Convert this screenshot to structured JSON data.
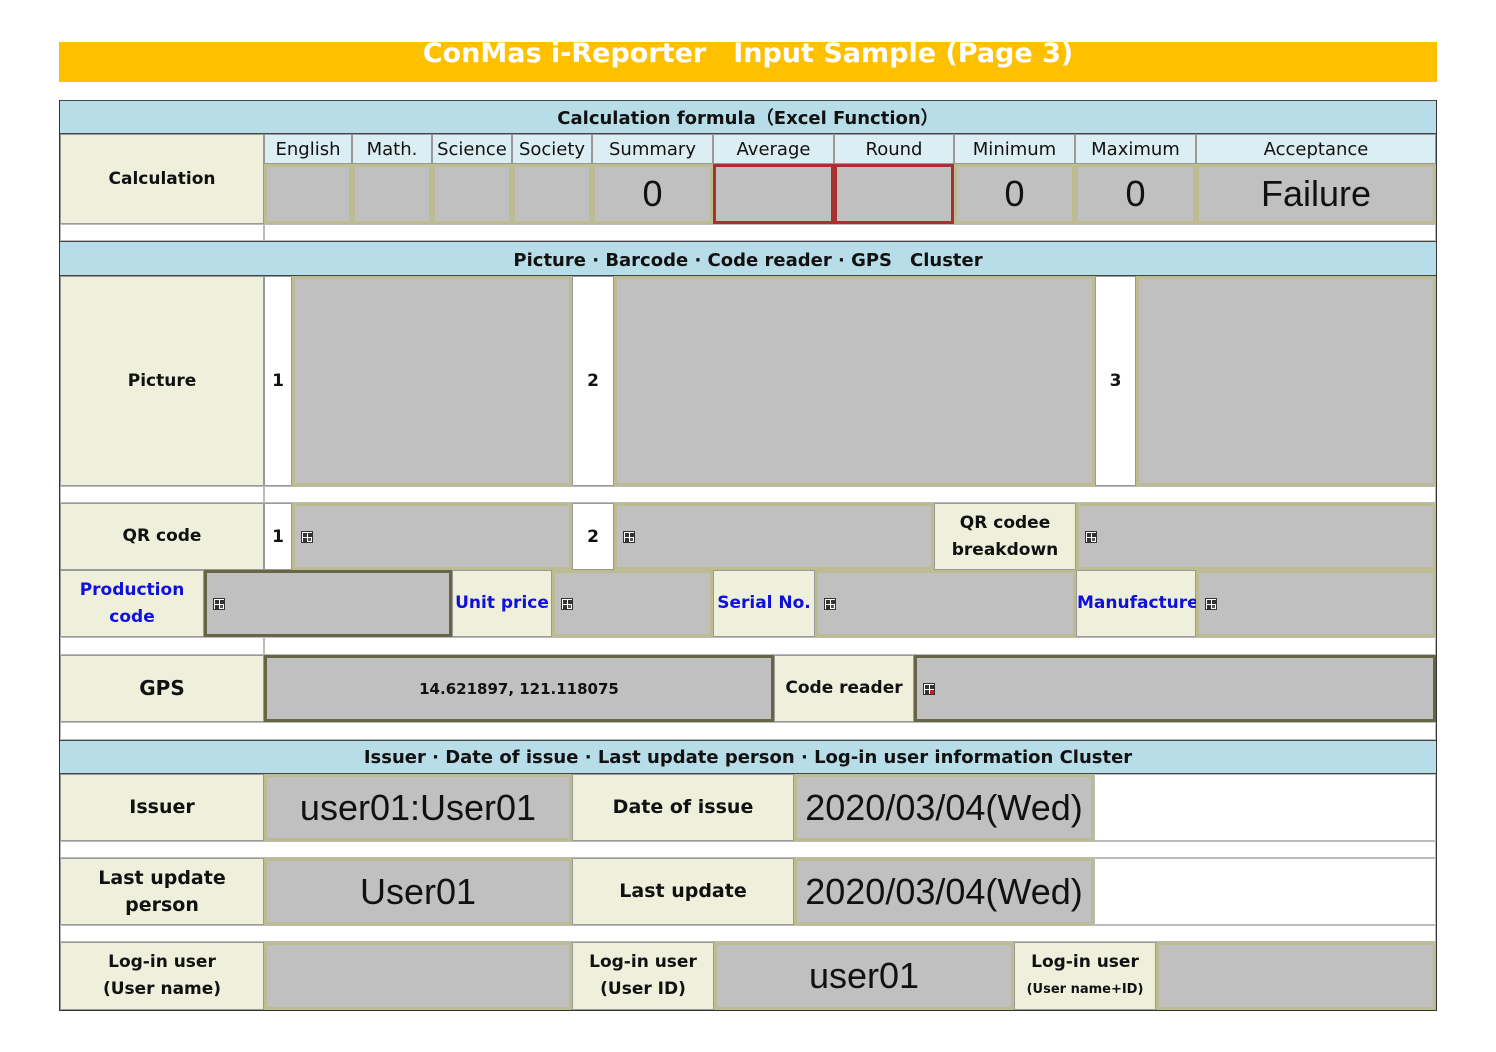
{
  "title": "ConMas i-Reporter　Input Sample (Page 3)",
  "sections": {
    "calc": "Calculation formula（Excel Function）",
    "media": "Picture · Barcode · Code reader · GPS　Cluster",
    "issuer": "Issuer · Date of issue · Last update person · Log-in user information  Cluster"
  },
  "calc": {
    "label": "Calculation",
    "headers": [
      "English",
      "Math.",
      "Science",
      "Society",
      "Summary",
      "Average",
      "Round",
      "Minimum",
      "Maximum",
      "Acceptance"
    ],
    "values": [
      "",
      "",
      "",
      "",
      "0",
      "",
      "",
      "0",
      "0",
      "Failure"
    ]
  },
  "picture": {
    "label": "Picture",
    "nums": [
      "1",
      "2",
      "3"
    ]
  },
  "qr": {
    "label": "QR code",
    "nums": [
      "1",
      "2"
    ],
    "breakdown": "QR codee breakdown"
  },
  "codes": {
    "production": "Production code",
    "unit_price": "Unit price",
    "serial": "Serial No.",
    "manufacturer": "Manufacturer"
  },
  "gps": {
    "label": "GPS",
    "value": "14.621897, 121.118075",
    "code_reader": "Code reader"
  },
  "issuer": {
    "issuer_label": "Issuer",
    "issuer_value": "user01:User01",
    "date_label": "Date of issue",
    "date_value": "2020/03/04(Wed)",
    "update_person_label": "Last update person",
    "update_person_value": "User01",
    "update_label": "Last update",
    "update_value": "2020/03/04(Wed)",
    "login_name_label_1": "Log-in user",
    "login_name_label_2": "(User name)",
    "login_name_value": "",
    "login_id_label_1": "Log-in user",
    "login_id_label_2": "(User ID)",
    "login_id_value": "user01",
    "login_both_label_1": "Log-in user",
    "login_both_label_2": "(User name+ID)",
    "login_both_value": ""
  },
  "icons": [
    "qr-code-icon",
    "barcode-reader-icon"
  ],
  "colors": {
    "banner": "#ffc000",
    "section": "#b7dde8",
    "label_bg": "#eef0dc",
    "field_bg": "#c0c0c0",
    "link_blue": "#1010dd"
  }
}
